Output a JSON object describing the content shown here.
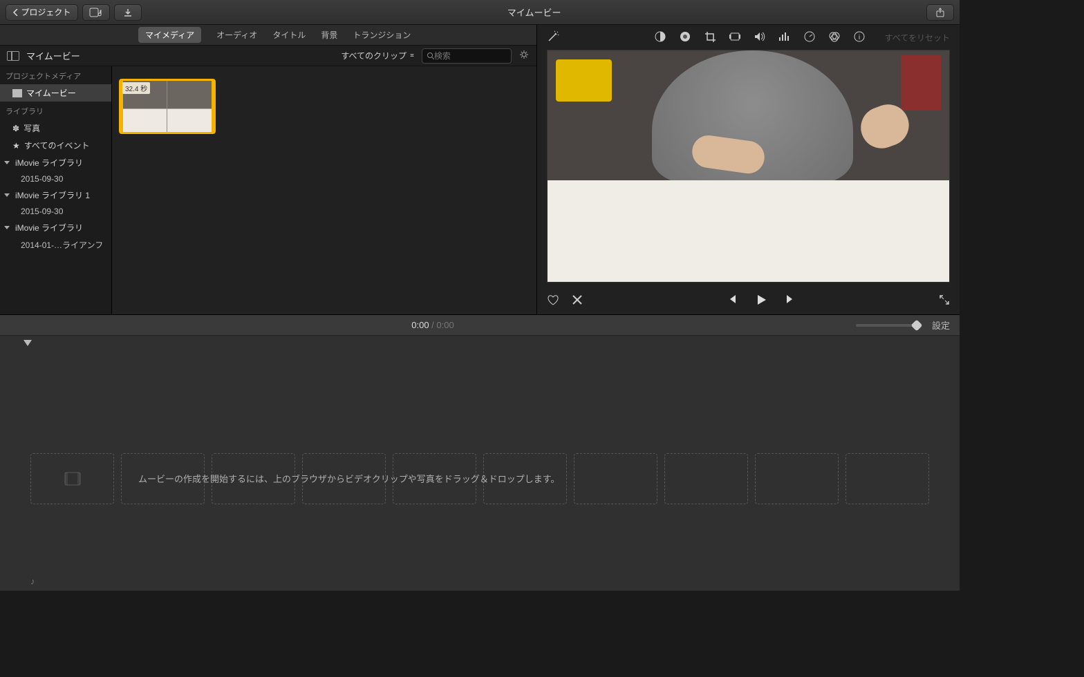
{
  "titlebar": {
    "back_label": "プロジェクト",
    "title": "マイムービー"
  },
  "media_tabs": {
    "my_media": "マイメディア",
    "audio": "オーディオ",
    "titles": "タイトル",
    "backgrounds": "背景",
    "transitions": "トランジション"
  },
  "browser_toolbar": {
    "title": "マイムービー",
    "clip_filter": "すべてのクリップ",
    "search_placeholder": "検索"
  },
  "sidebar": {
    "project_media_header": "プロジェクトメディア",
    "my_movie": "マイムービー",
    "library_header": "ライブラリ",
    "photos": "写真",
    "all_events": "すべてのイベント",
    "lib1": "iMovie ライブラリ",
    "lib1_date": "2015-09-30",
    "lib2": "iMovie ライブラリ 1",
    "lib2_date": "2015-09-30",
    "lib3": "iMovie ライブラリ",
    "lib3_date": "2014-01-…ライアンフ"
  },
  "clip": {
    "duration": "32.4 秒"
  },
  "viewer": {
    "reset": "すべてをリセット"
  },
  "timeline": {
    "current": "0:00",
    "separator": " / ",
    "total": "0:00",
    "settings": "設定",
    "hint": "ムービーの作成を開始するには、上のブラウザからビデオクリップや写真をドラッグ＆ドロップします。"
  }
}
